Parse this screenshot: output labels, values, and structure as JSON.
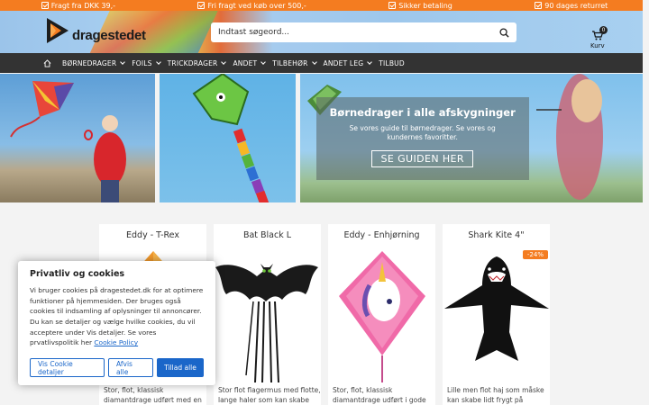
{
  "topbar": {
    "usps": [
      "Fragt fra DKK 39,-",
      "Fri fragt ved køb over 500,-",
      "Sikker betaling",
      "90 dages returret"
    ]
  },
  "header": {
    "logo_text": "dragestedet",
    "search_placeholder": "Indtast søgeord...",
    "cart_label": "Kurv",
    "cart_count": "0"
  },
  "nav": {
    "items": [
      {
        "label": "BØRNEDRAGER",
        "dropdown": true
      },
      {
        "label": "FOILS",
        "dropdown": true
      },
      {
        "label": "TRICKDRAGER",
        "dropdown": true
      },
      {
        "label": "ANDET",
        "dropdown": true
      },
      {
        "label": "TILBEHØR",
        "dropdown": true
      },
      {
        "label": "ANDET LEG",
        "dropdown": true
      },
      {
        "label": "TILBUD",
        "dropdown": false
      }
    ]
  },
  "hero": {
    "title": "Børnedrager i alle afskygninger",
    "text": "Se vores guide til børnedrager. Se vores og kundernes favoritter.",
    "button": "SE GUIDEN HER"
  },
  "products": [
    {
      "name": "Eddy - T-Rex",
      "desc": [
        "Stor, flot, klassisk",
        "diamantdrage udført med en"
      ],
      "sale": ""
    },
    {
      "name": "Bat Black L",
      "desc": [
        "Stor flot flagermus med flotte,",
        "lange haler som kan skabe"
      ],
      "sale": ""
    },
    {
      "name": "Eddy - Enhjørning",
      "desc": [
        "Stor, flot, klassisk",
        "diamantdrage udført i gode"
      ],
      "sale": ""
    },
    {
      "name": "Shark Kite 4\"",
      "desc": [
        "Lille men flot haj som måske",
        "kan skabe lidt frygt på"
      ],
      "sale": "-24%"
    }
  ],
  "cookie": {
    "title": "Privatliv og cookies",
    "text": "Vi bruger cookies på dragestedet.dk for at optimere funktioner på hjemmesiden. Der bruges også cookies til indsamling af oplysninger til annoncører. Du kan se detaljer og vælge hvilke cookies, du vil acceptere under Vis detaljer. Se vores prvatlivspolitik her",
    "link": "Cookie Policy",
    "btn_details": "Vis Cookie detaljer",
    "btn_reject": "Afvis alle",
    "btn_accept": "Tillad alle"
  },
  "colors": {
    "accent": "#f47c20",
    "nav_bg": "#333333",
    "button_blue": "#1a66c9"
  }
}
